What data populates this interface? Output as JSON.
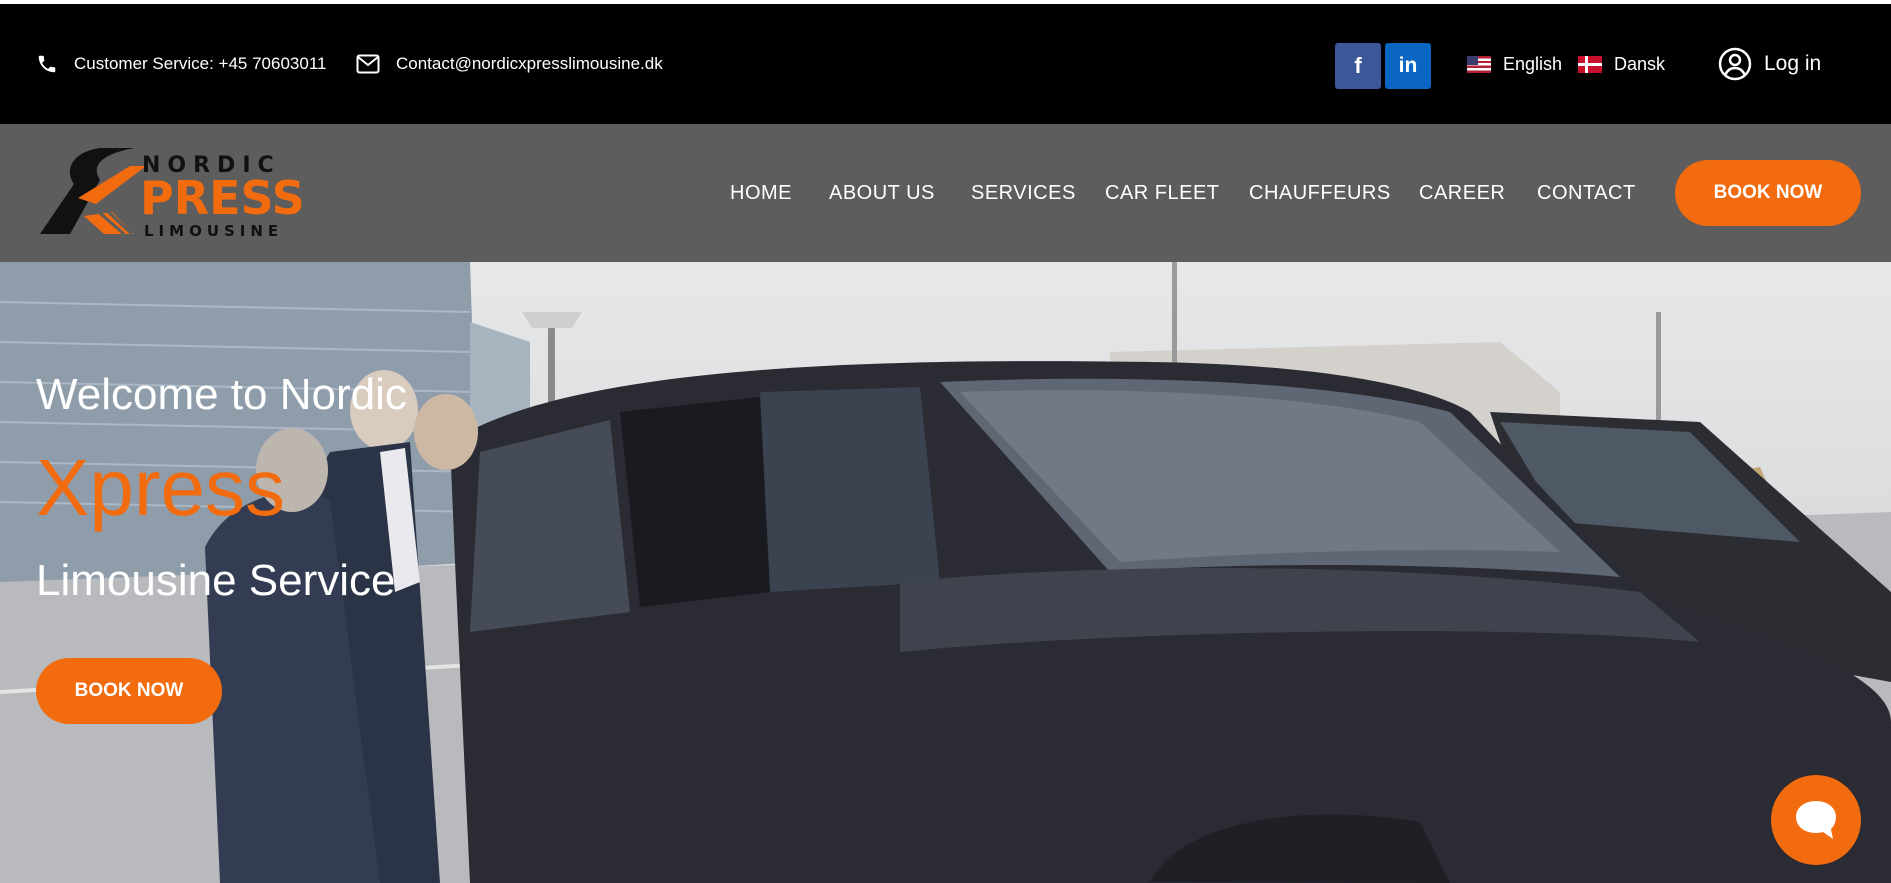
{
  "topbar": {
    "phone_text": "Customer Service: +45 70603011",
    "email_text": "Contact@nordicxpresslimousine.dk",
    "social": [
      "f",
      "in"
    ],
    "languages": [
      "English",
      "Dansk"
    ],
    "login_label": "Log in"
  },
  "nav": {
    "items": [
      "HOME",
      "ABOUT US",
      "SERVICES",
      "CAR FLEET",
      "CHAUFFEURS",
      "CAREER",
      "CONTACT"
    ],
    "book_label": "BOOK NOW"
  },
  "logo": {
    "line1": "NORDIC",
    "line2": "PRESS",
    "line3": "LIMOUSINE"
  },
  "hero": {
    "welcome": "Welcome to Nordic",
    "highlight": "Xpress",
    "subtitle": "Limousine Service",
    "book_label": "BOOK NOW"
  },
  "colors": {
    "accent": "#f26b0f",
    "topbar_bg": "#000000",
    "navbar_bg": "#5d5d5d",
    "facebook": "#3b5998",
    "linkedin": "#0a66c2"
  },
  "icons": [
    "phone-icon",
    "envelope-icon",
    "facebook-icon",
    "linkedin-icon",
    "us-flag-icon",
    "danish-flag-icon",
    "user-circle-icon",
    "chat-icon"
  ]
}
